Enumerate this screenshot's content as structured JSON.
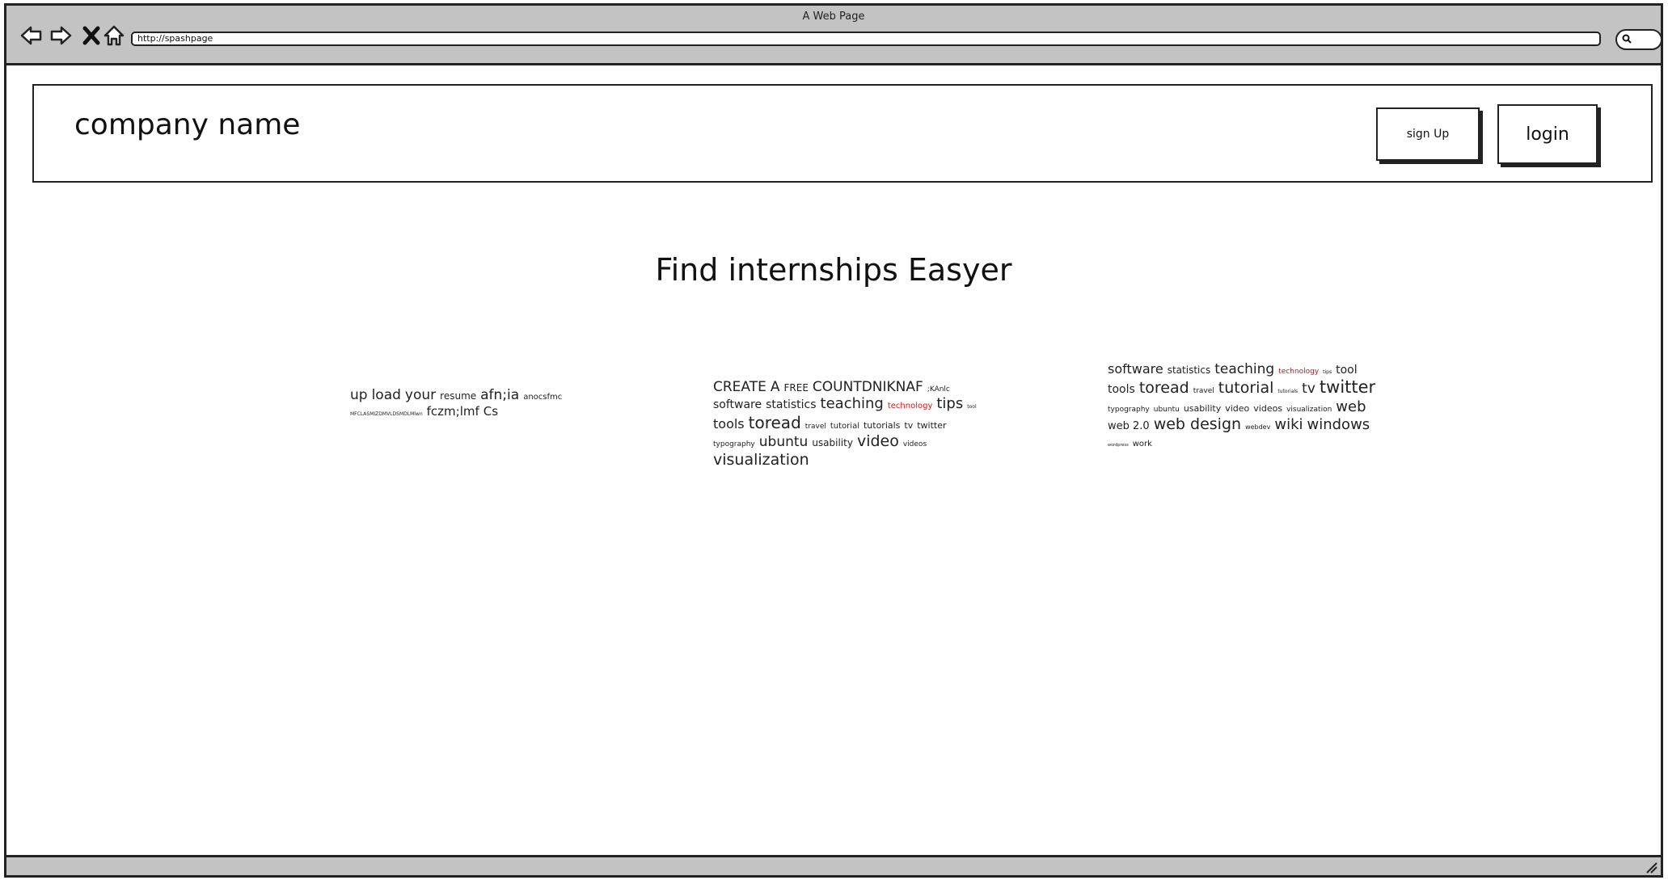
{
  "browser": {
    "title": "A Web Page",
    "url": "http://spashpage"
  },
  "header": {
    "company_name": "company name",
    "signup_label": "sign Up",
    "login_label": "login"
  },
  "hero": {
    "title": "Find internships Easyer"
  },
  "tag_clouds": [
    {
      "words": [
        {
          "text": "up",
          "size": 17
        },
        {
          "text": "load",
          "size": 17
        },
        {
          "text": "your",
          "size": 17
        },
        {
          "text": "resume",
          "size": 12
        },
        {
          "text": "afn;ia",
          "size": 17
        },
        {
          "text": "anocsfmc",
          "size": 10
        },
        {
          "text": "MFCLASMIZDMVLDSMDLMlwn",
          "size": 6
        },
        {
          "text": "fczm;lmf",
          "size": 15
        },
        {
          "text": "Cs",
          "size": 15
        }
      ]
    },
    {
      "words": [
        {
          "text": "CREATE",
          "size": 17
        },
        {
          "text": "A",
          "size": 17
        },
        {
          "text": "FREE",
          "size": 12
        },
        {
          "text": "COUNTDNIKNAF",
          "size": 17
        },
        {
          "text": ";KAnlc",
          "size": 9
        },
        {
          "text": "software",
          "size": 14
        },
        {
          "text": "statistics",
          "size": 14
        },
        {
          "text": "teaching",
          "size": 18
        },
        {
          "text": "technology",
          "size": 10,
          "color": "#e01010"
        },
        {
          "text": "tips",
          "size": 18
        },
        {
          "text": "tool",
          "size": 6
        },
        {
          "text": "tools",
          "size": 16
        },
        {
          "text": "toread",
          "size": 20
        },
        {
          "text": "travel",
          "size": 9
        },
        {
          "text": "tutorial",
          "size": 10
        },
        {
          "text": "tutorials",
          "size": 11
        },
        {
          "text": "tv",
          "size": 11
        },
        {
          "text": "twitter",
          "size": 11
        },
        {
          "text": "typography",
          "size": 9
        },
        {
          "text": "ubuntu",
          "size": 17
        },
        {
          "text": "usability",
          "size": 12
        },
        {
          "text": "video",
          "size": 19
        },
        {
          "text": "videos",
          "size": 9
        },
        {
          "text": "visualization",
          "size": 19
        }
      ]
    },
    {
      "words": [
        {
          "text": "software",
          "size": 16
        },
        {
          "text": "statistics",
          "size": 12
        },
        {
          "text": "teaching",
          "size": 17
        },
        {
          "text": "technology",
          "size": 9,
          "color": "#e01010"
        },
        {
          "text": "tips",
          "size": 6
        },
        {
          "text": "tool",
          "size": 14
        },
        {
          "text": "tools",
          "size": 14
        },
        {
          "text": "toread",
          "size": 19
        },
        {
          "text": "travel",
          "size": 9
        },
        {
          "text": "tutorial",
          "size": 19
        },
        {
          "text": "tutorials",
          "size": 6
        },
        {
          "text": "tv",
          "size": 17
        },
        {
          "text": "twitter",
          "size": 21
        },
        {
          "text": "typography",
          "size": 9
        },
        {
          "text": "ubuntu",
          "size": 9
        },
        {
          "text": "usability",
          "size": 11
        },
        {
          "text": "video",
          "size": 11
        },
        {
          "text": "videos",
          "size": 11
        },
        {
          "text": "visualization",
          "size": 9
        },
        {
          "text": "web",
          "size": 18
        },
        {
          "text": "web 2.0",
          "size": 13
        },
        {
          "text": "web design",
          "size": 19
        },
        {
          "text": "webdev",
          "size": 8
        },
        {
          "text": "wiki",
          "size": 18
        },
        {
          "text": "windows",
          "size": 18
        },
        {
          "text": "wordpress",
          "size": 5
        },
        {
          "text": "work",
          "size": 10
        }
      ]
    }
  ]
}
